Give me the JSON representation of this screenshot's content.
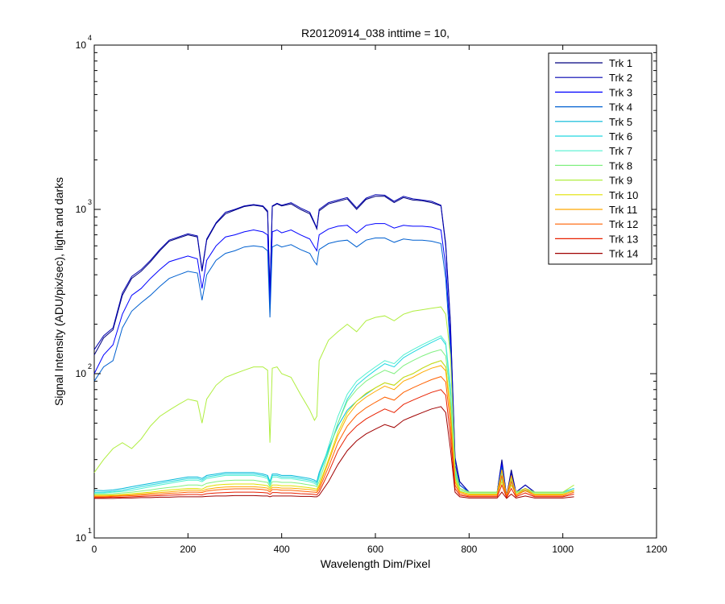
{
  "chart_data": {
    "type": "line",
    "title": "R20120914_038 inttime = 10,",
    "xlabel": "Wavelength Dim/Pixel",
    "ylabel": "Signal Intensity (ADU/pix/sec), light and darks",
    "xlim": [
      0,
      1200
    ],
    "ylim": [
      10,
      10000
    ],
    "yscale": "log",
    "x_ticks": [
      "0",
      "200",
      "400",
      "600",
      "800",
      "1000",
      "1200"
    ],
    "y_ticks": [
      {
        "base": "10",
        "exp": "1"
      },
      {
        "base": "10",
        "exp": "2"
      },
      {
        "base": "10",
        "exp": "3"
      },
      {
        "base": "10",
        "exp": "4"
      }
    ],
    "grid": false,
    "legend_position": "top-right",
    "x": [
      0,
      20,
      40,
      60,
      80,
      100,
      120,
      140,
      160,
      180,
      200,
      220,
      230,
      240,
      260,
      280,
      300,
      320,
      340,
      360,
      370,
      375,
      380,
      390,
      400,
      420,
      440,
      460,
      470,
      475,
      480,
      500,
      520,
      540,
      560,
      580,
      600,
      620,
      640,
      660,
      680,
      700,
      720,
      740,
      750,
      760,
      770,
      780,
      800,
      820,
      840,
      860,
      870,
      880,
      890,
      900,
      920,
      940,
      960,
      980,
      1000,
      1024
    ],
    "series": [
      {
        "name": "Trk 1",
        "color": "#00007f",
        "values": [
          130,
          165,
          185,
          300,
          380,
          420,
          480,
          560,
          640,
          670,
          700,
          680,
          420,
          650,
          820,
          940,
          990,
          1040,
          1060,
          1040,
          960,
          300,
          1040,
          1080,
          1050,
          1080,
          1000,
          940,
          820,
          760,
          980,
          1080,
          1120,
          1160,
          1000,
          1150,
          1200,
          1200,
          1100,
          1180,
          1140,
          1130,
          1100,
          1050,
          600,
          200,
          30,
          22,
          19,
          19,
          19,
          19,
          30,
          18,
          26,
          19,
          21,
          19,
          19,
          19,
          19,
          20
        ]
      },
      {
        "name": "Trk 2",
        "color": "#0000b0",
        "values": [
          140,
          170,
          190,
          310,
          390,
          430,
          490,
          570,
          650,
          680,
          710,
          690,
          430,
          660,
          830,
          960,
          1000,
          1050,
          1070,
          1050,
          980,
          310,
          1050,
          1090,
          1060,
          1100,
          1020,
          960,
          830,
          770,
          1000,
          1100,
          1140,
          1180,
          1020,
          1170,
          1230,
          1220,
          1120,
          1200,
          1160,
          1140,
          1120,
          1060,
          620,
          210,
          31,
          22,
          19,
          19,
          19,
          19,
          29,
          18,
          25,
          19,
          21,
          19,
          19,
          19,
          19,
          20
        ]
      },
      {
        "name": "Trk 3",
        "color": "#0000ff",
        "values": [
          100,
          130,
          150,
          230,
          300,
          330,
          380,
          430,
          480,
          500,
          520,
          500,
          330,
          490,
          600,
          680,
          700,
          730,
          750,
          730,
          700,
          260,
          730,
          750,
          720,
          750,
          700,
          660,
          590,
          560,
          700,
          760,
          790,
          800,
          720,
          800,
          820,
          820,
          770,
          800,
          790,
          790,
          780,
          750,
          450,
          160,
          28,
          21,
          19,
          19,
          19,
          19,
          28,
          18,
          24,
          19,
          20,
          19,
          19,
          19,
          19,
          20
        ]
      },
      {
        "name": "Trk 4",
        "color": "#0060d0",
        "values": [
          90,
          110,
          120,
          190,
          240,
          270,
          300,
          340,
          380,
          400,
          420,
          410,
          280,
          400,
          490,
          540,
          560,
          590,
          600,
          590,
          560,
          220,
          590,
          610,
          590,
          610,
          570,
          540,
          480,
          460,
          570,
          620,
          640,
          650,
          590,
          650,
          670,
          670,
          630,
          660,
          650,
          650,
          640,
          620,
          380,
          140,
          27,
          21,
          19,
          19,
          19,
          19,
          27,
          18,
          23,
          19,
          20,
          19,
          19,
          19,
          19,
          20
        ]
      },
      {
        "name": "Trk 5",
        "color": "#00b8d8",
        "values": [
          19.5,
          19.4,
          19.6,
          20,
          20.5,
          21,
          21.5,
          22,
          22.5,
          23,
          23.5,
          23.5,
          23,
          24,
          24.5,
          25,
          25,
          25,
          25,
          24.5,
          24,
          22,
          24.5,
          24.5,
          24,
          24,
          23.5,
          23,
          22.5,
          22,
          25,
          35,
          48,
          60,
          68,
          75,
          82,
          88,
          85,
          95,
          100,
          108,
          115,
          120,
          110,
          60,
          24,
          20,
          19,
          19,
          19,
          19,
          24,
          18,
          22,
          19,
          20,
          19,
          19,
          19,
          19,
          20
        ]
      },
      {
        "name": "Trk 6",
        "color": "#20d8e0",
        "values": [
          19,
          19,
          19.2,
          19.5,
          20,
          20.5,
          21,
          21.5,
          22,
          22.5,
          23,
          23,
          22.5,
          23.5,
          24,
          24.5,
          24.5,
          24.5,
          24.5,
          24,
          23.5,
          21.5,
          24,
          24,
          23.5,
          23.5,
          23,
          22.5,
          22,
          21.5,
          24,
          34,
          50,
          70,
          85,
          95,
          105,
          115,
          110,
          125,
          135,
          145,
          155,
          165,
          150,
          80,
          25,
          20,
          19,
          19,
          19,
          19,
          25,
          18,
          22,
          19,
          20,
          19,
          19,
          19,
          19,
          20
        ]
      },
      {
        "name": "Trk 7",
        "color": "#50f0d0",
        "values": [
          18.8,
          18.8,
          19,
          19.2,
          19.5,
          20,
          20.5,
          21,
          21.5,
          22,
          22.5,
          22.5,
          22,
          23,
          23.5,
          24,
          24,
          24,
          24,
          23.5,
          23,
          21,
          23.5,
          23.5,
          23,
          23,
          22.5,
          22,
          21.5,
          21,
          23.5,
          36,
          55,
          75,
          90,
          100,
          110,
          120,
          115,
          130,
          140,
          150,
          160,
          170,
          155,
          85,
          26,
          20,
          19,
          19,
          19,
          19,
          25,
          18,
          22,
          19,
          20,
          19,
          19,
          19,
          19,
          20
        ]
      },
      {
        "name": "Trk 8",
        "color": "#80f080",
        "values": [
          18.5,
          18.5,
          18.6,
          18.8,
          19,
          19.3,
          19.6,
          20,
          20.3,
          20.6,
          21,
          21,
          20.8,
          21.5,
          22,
          22.3,
          22.5,
          22.5,
          22.5,
          22,
          21.8,
          20.5,
          22,
          22,
          21.8,
          21.8,
          21.5,
          21,
          20.8,
          20.5,
          22,
          33,
          50,
          68,
          80,
          90,
          98,
          105,
          100,
          112,
          120,
          128,
          135,
          140,
          128,
          72,
          24,
          19.5,
          18.8,
          18.8,
          18.8,
          18.8,
          23,
          18,
          21,
          18.8,
          19.5,
          18.8,
          18.8,
          18.8,
          18.8,
          19.5
        ]
      },
      {
        "name": "Trk 9",
        "color": "#b0ee40",
        "values": [
          25,
          30,
          35,
          38,
          35,
          40,
          48,
          55,
          60,
          65,
          70,
          68,
          50,
          70,
          85,
          95,
          100,
          105,
          110,
          110,
          105,
          38,
          108,
          110,
          100,
          95,
          75,
          60,
          52,
          55,
          120,
          160,
          180,
          200,
          180,
          210,
          220,
          225,
          210,
          230,
          240,
          245,
          250,
          255,
          230,
          130,
          27,
          20,
          19,
          19,
          19,
          19,
          26,
          18,
          23,
          19,
          20,
          19,
          19,
          19,
          19,
          21
        ]
      },
      {
        "name": "Trk 10",
        "color": "#e0e000",
        "values": [
          18.2,
          18.2,
          18.3,
          18.4,
          18.6,
          18.8,
          19,
          19.3,
          19.6,
          19.8,
          20,
          20,
          19.8,
          20.5,
          21,
          21.2,
          21.3,
          21.3,
          21.3,
          21,
          20.8,
          20,
          21,
          21,
          20.8,
          20.8,
          20.5,
          20.2,
          20,
          19.8,
          21,
          30,
          44,
          58,
          68,
          76,
          82,
          88,
          85,
          95,
          100,
          108,
          115,
          120,
          110,
          62,
          23,
          19.2,
          18.5,
          18.5,
          18.5,
          18.5,
          22,
          18,
          21,
          18.5,
          19.3,
          18.5,
          18.5,
          18.5,
          18.5,
          19.3
        ]
      },
      {
        "name": "Trk 11",
        "color": "#ffa800",
        "values": [
          18,
          18,
          18.1,
          18.2,
          18.3,
          18.5,
          18.7,
          18.9,
          19.1,
          19.3,
          19.5,
          19.5,
          19.3,
          19.8,
          20.2,
          20.4,
          20.5,
          20.5,
          20.5,
          20.3,
          20.1,
          19.5,
          20.3,
          20.3,
          20.1,
          20.1,
          19.9,
          19.7,
          19.5,
          19.3,
          20.5,
          29,
          42,
          55,
          65,
          72,
          78,
          84,
          80,
          90,
          95,
          102,
          108,
          112,
          104,
          58,
          22,
          19,
          18.3,
          18.3,
          18.3,
          18.3,
          26,
          18,
          24,
          18.3,
          20,
          18.3,
          18.3,
          18.3,
          18.3,
          19.5
        ]
      },
      {
        "name": "Trk 12",
        "color": "#ff6000",
        "values": [
          17.8,
          17.8,
          17.9,
          18,
          18.1,
          18.2,
          18.4,
          18.5,
          18.7,
          18.8,
          19,
          19,
          18.9,
          19.3,
          19.6,
          19.8,
          19.9,
          19.9,
          19.9,
          19.7,
          19.5,
          19,
          19.7,
          19.7,
          19.5,
          19.5,
          19.3,
          19.1,
          19,
          18.9,
          19.8,
          27,
          38,
          48,
          56,
          62,
          67,
          72,
          69,
          77,
          82,
          87,
          92,
          96,
          89,
          50,
          21,
          18.6,
          18,
          18,
          18,
          18,
          24,
          17.8,
          22,
          18,
          19.5,
          18,
          18,
          18,
          18,
          19
        ]
      },
      {
        "name": "Trk 13",
        "color": "#e82000",
        "values": [
          17.6,
          17.6,
          17.7,
          17.7,
          17.8,
          17.9,
          18,
          18.1,
          18.2,
          18.3,
          18.4,
          18.4,
          18.3,
          18.6,
          18.8,
          18.9,
          19,
          19,
          19,
          18.9,
          18.8,
          18.4,
          18.9,
          18.9,
          18.8,
          18.8,
          18.6,
          18.5,
          18.4,
          18.3,
          19,
          25,
          34,
          42,
          48,
          53,
          57,
          61,
          58,
          65,
          69,
          73,
          77,
          80,
          74,
          42,
          20,
          18.2,
          17.8,
          17.8,
          17.8,
          17.8,
          21,
          17.6,
          20,
          17.8,
          18.8,
          17.8,
          17.8,
          17.8,
          17.8,
          18.5
        ]
      },
      {
        "name": "Trk 14",
        "color": "#a00000",
        "values": [
          17.4,
          17.4,
          17.4,
          17.5,
          17.5,
          17.6,
          17.6,
          17.7,
          17.7,
          17.8,
          17.8,
          17.8,
          17.8,
          17.9,
          18,
          18,
          18.1,
          18.1,
          18.1,
          18,
          18,
          17.8,
          18,
          18,
          18,
          18,
          17.9,
          17.9,
          17.8,
          17.8,
          18.2,
          22,
          28,
          34,
          39,
          43,
          46,
          49,
          47,
          52,
          55,
          58,
          61,
          63,
          58,
          35,
          19,
          17.8,
          17.5,
          17.5,
          17.5,
          17.5,
          19,
          17.4,
          18.5,
          17.5,
          18,
          17.5,
          17.5,
          17.5,
          17.5,
          17.8
        ]
      }
    ]
  }
}
